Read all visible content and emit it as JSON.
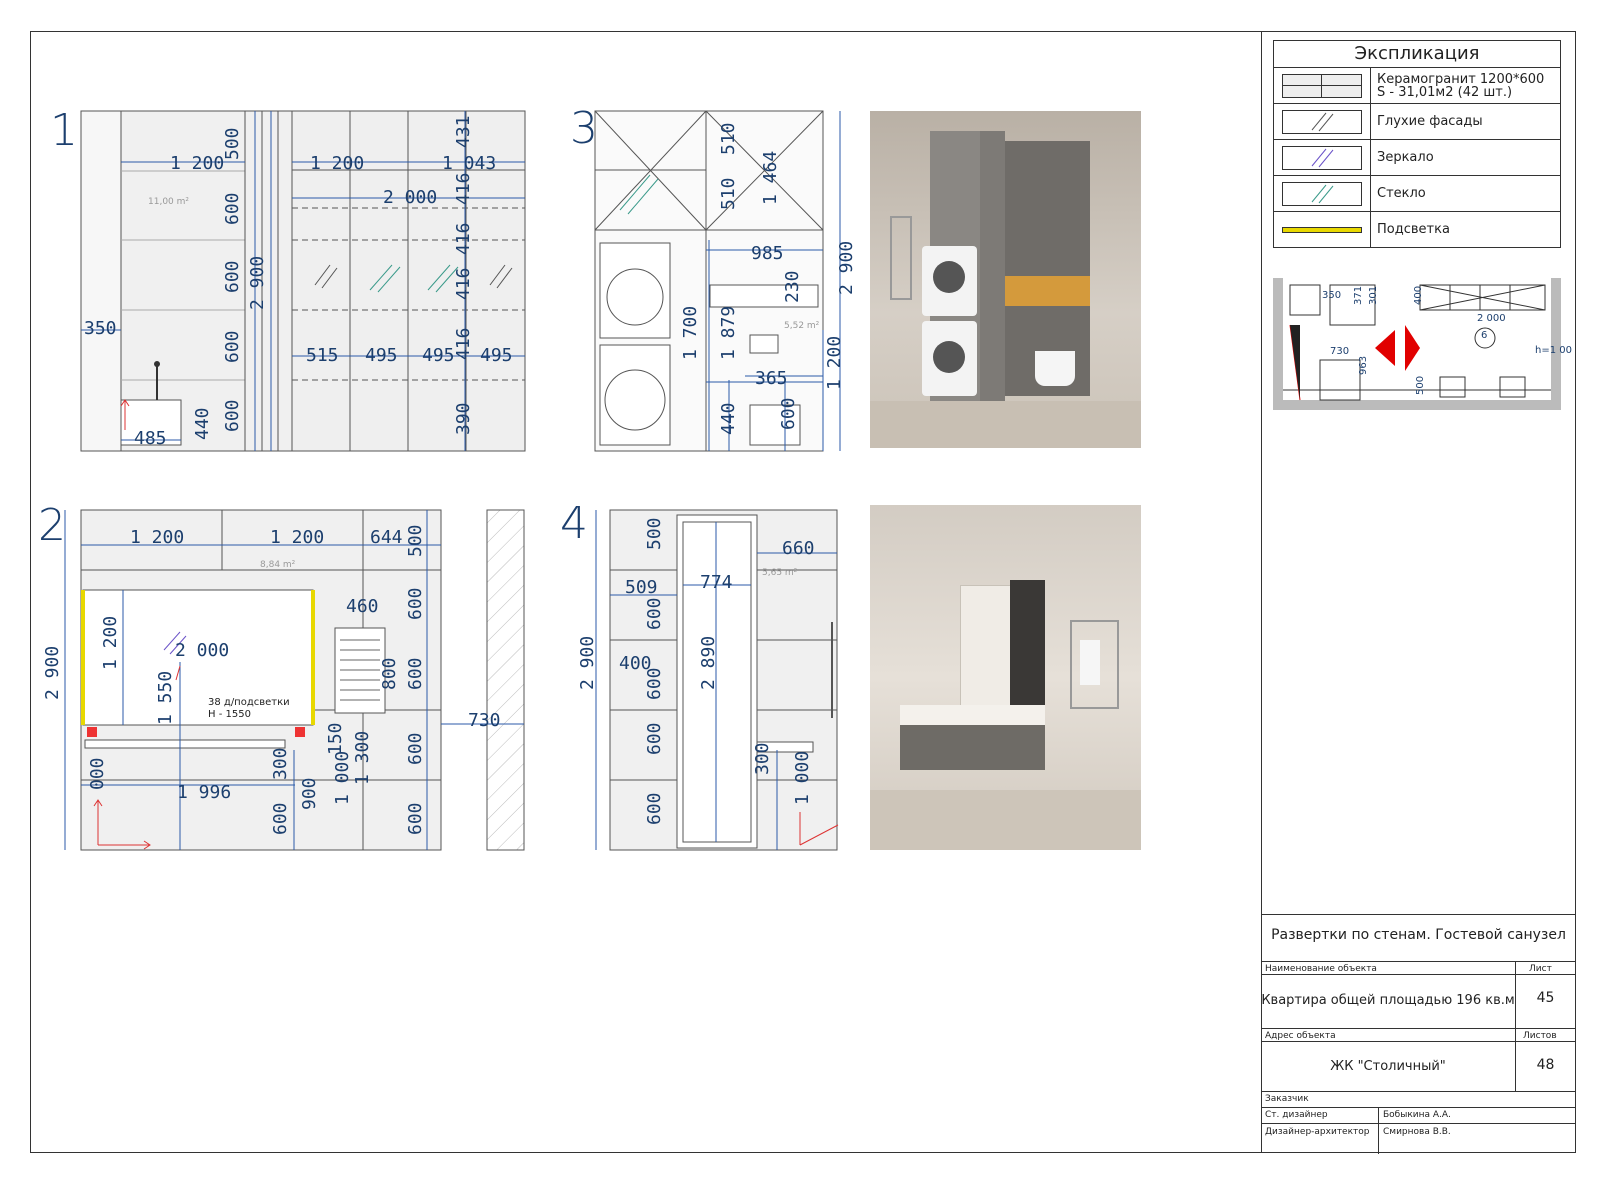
{
  "sheet": {
    "view_numbers": [
      "1",
      "2",
      "3",
      "4"
    ]
  },
  "view1": {
    "dims": [
      "1 200",
      "1 200",
      "1 043",
      "2 000",
      "350",
      "485",
      "440",
      "600",
      "600",
      "600",
      "600",
      "500",
      "2 900",
      "515",
      "495",
      "495",
      "495",
      "431",
      "416",
      "416",
      "416",
      "416",
      "390"
    ],
    "area": "11,00 m²"
  },
  "view2": {
    "dims": [
      "1 200",
      "1 200",
      "644",
      "500",
      "460",
      "600",
      "600",
      "800",
      "2 000",
      "1 200",
      "1 550",
      "2 900",
      "730",
      "600",
      "150",
      "300",
      "900",
      "1 000",
      "1 300",
      "600",
      "600",
      "1 996",
      "000"
    ],
    "area": "8,84 m²",
    "note_line1": "38 д/подсветки",
    "note_line2": "H - 1550"
  },
  "view3": {
    "dims": [
      "510",
      "510",
      "1 464",
      "985",
      "230",
      "2 900",
      "1 700",
      "1 879",
      "365",
      "1 200",
      "440",
      "600"
    ],
    "area": "5,52 m²"
  },
  "view4": {
    "dims": [
      "500",
      "660",
      "509",
      "774",
      "600",
      "400",
      "600",
      "2 900",
      "2 890",
      "600",
      "600",
      "300",
      "1 000"
    ],
    "area": "5,65 m²"
  },
  "legend": {
    "title": "Экспликация",
    "items": [
      {
        "label_line1": "Керамогранит 1200*600",
        "label_line2": "S - 31,01м2 (42 шт.)"
      },
      {
        "label_line1": "Глухие фасады",
        "label_line2": ""
      },
      {
        "label_line1": "Зеркало",
        "label_line2": ""
      },
      {
        "label_line1": "Стекло",
        "label_line2": ""
      },
      {
        "label_line1": "Подсветка",
        "label_line2": ""
      }
    ]
  },
  "plan": {
    "labels": [
      "350",
      "371",
      "301",
      "400",
      "2 000",
      "730",
      "963",
      "500",
      "h=1 00",
      "6"
    ]
  },
  "title_block": {
    "sheet_title": "Развертки по стенам. Гостевой санузел",
    "object_label": "Наименование объекта",
    "object_value": "Квартира общей площадью 196 кв.м",
    "sheet_label": "Лист",
    "sheet_value": "45",
    "address_label": "Адрес объекта",
    "address_value": "ЖК \"Столичный\"",
    "sheets_label": "Листов",
    "sheets_value": "48",
    "customer_label": "Заказчик",
    "lead_designer_label": "Ст. дизайнер",
    "lead_designer_value": "Бобыкина А.А.",
    "architect_label": "Дизайнер-архитектор",
    "architect_value": "Смирнова В.В."
  },
  "colors": {
    "drawing_line": "#2b5aa8",
    "dimension_text": "#1c3f6e",
    "backlight": "#e8d800",
    "mirror_hatch": "#6a52c8",
    "glass_hatch": "#3a9a8a",
    "tile": "#eeeeee"
  }
}
